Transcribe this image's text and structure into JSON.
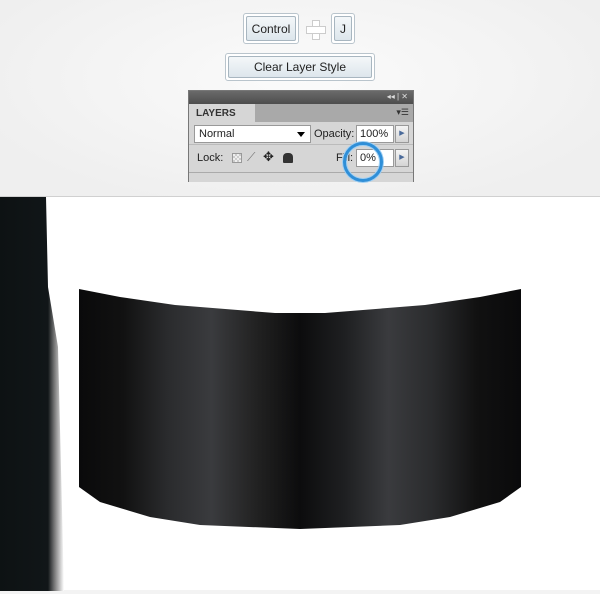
{
  "shortcut": {
    "key1": "Control",
    "key2": "J",
    "plus_icon": "plus-icon"
  },
  "clear_button": "Clear Layer Style",
  "layers_panel": {
    "header_controls": "◂◂ | ✕",
    "tab": "LAYERS",
    "menu_icon": "▾☰",
    "blend_mode": "Normal",
    "opacity_label": "Opacity:",
    "opacity_value": "100%",
    "lock_label": "Lock:",
    "fill_label": "Fill:",
    "fill_value": "0%"
  },
  "highlight_color": "#2f8fd8"
}
